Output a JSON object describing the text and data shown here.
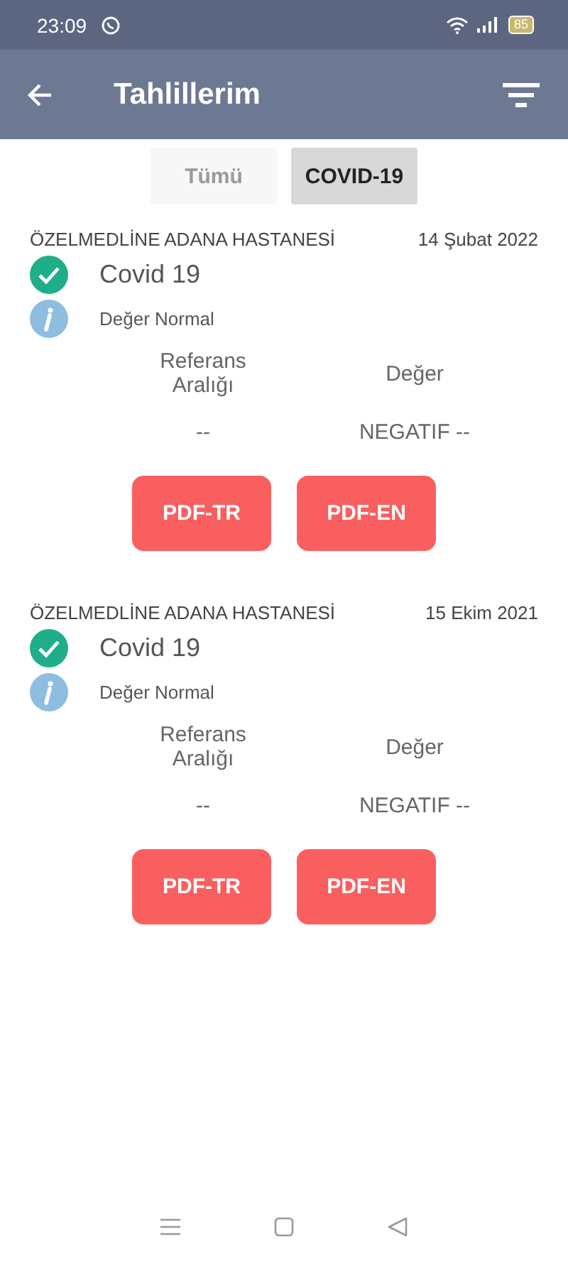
{
  "status_bar": {
    "time": "23:09",
    "battery": "85"
  },
  "app_bar": {
    "title": "Tahlillerim"
  },
  "tabs": [
    {
      "label": "Tümü",
      "selected": false
    },
    {
      "label": "COVID-19",
      "selected": true
    }
  ],
  "results": [
    {
      "hospital": "ÖZELMEDLİNE ADANA HASTANESİ",
      "date": "14 Şubat 2022",
      "test": "Covid 19",
      "status": "Değer Normal",
      "reference_header": "Referans Aralığı",
      "value_header": "Değer",
      "reference": "--",
      "value": "NEGATIF --",
      "buttons": [
        "PDF-TR",
        "PDF-EN"
      ]
    },
    {
      "hospital": "ÖZELMEDLİNE ADANA HASTANESİ",
      "date": "15 Ekim 2021",
      "test": "Covid 19",
      "status": "Değer Normal",
      "reference_header": "Referans Aralığı",
      "value_header": "Değer",
      "reference": "--",
      "value": "NEGATIF --",
      "buttons": [
        "PDF-TR",
        "PDF-EN"
      ]
    }
  ]
}
